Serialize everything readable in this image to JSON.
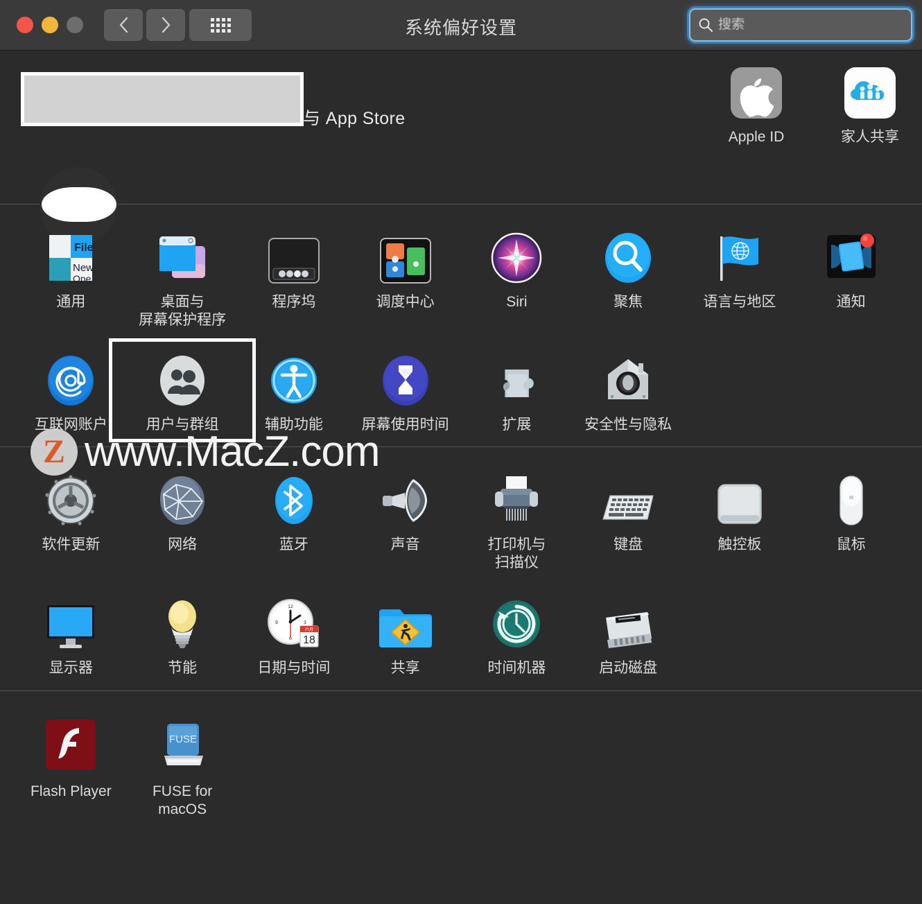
{
  "window": {
    "title": "系统偏好设置",
    "traffic_lights": [
      "close",
      "minimize",
      "zoom"
    ],
    "back_label": "‹",
    "forward_label": "›",
    "grid_label": "show-all"
  },
  "search": {
    "placeholder": "搜索",
    "value": ""
  },
  "banner": {
    "text": "与 App Store",
    "top_right_tiles": [
      {
        "label": "Apple ID",
        "icon": "apple-logo-icon"
      },
      {
        "label": "家人共享",
        "icon": "family-sharing-icon"
      }
    ]
  },
  "panes": {
    "row1": [
      {
        "label": "通用",
        "icon": "general-icon"
      },
      {
        "label": "桌面与\n屏幕保护程序",
        "icon": "desktop-screensaver-icon"
      },
      {
        "label": "程序坞",
        "icon": "dock-icon"
      },
      {
        "label": "调度中心",
        "icon": "mission-control-icon"
      },
      {
        "label": "Siri",
        "icon": "siri-icon"
      },
      {
        "label": "聚焦",
        "icon": "spotlight-icon"
      },
      {
        "label": "语言与地区",
        "icon": "language-region-icon"
      },
      {
        "label": "通知",
        "icon": "notifications-icon"
      }
    ],
    "row2": [
      {
        "label": "互联网账户",
        "icon": "internet-accounts-icon"
      },
      {
        "label": "用户与群组",
        "icon": "users-groups-icon",
        "selected": true
      },
      {
        "label": "辅助功能",
        "icon": "accessibility-icon"
      },
      {
        "label": "屏幕使用时间",
        "icon": "screen-time-icon"
      },
      {
        "label": "扩展",
        "icon": "extensions-icon"
      },
      {
        "label": "安全性与隐私",
        "icon": "security-privacy-icon"
      }
    ],
    "row3": [
      {
        "label": "软件更新",
        "icon": "software-update-icon"
      },
      {
        "label": "网络",
        "icon": "network-icon"
      },
      {
        "label": "蓝牙",
        "icon": "bluetooth-icon"
      },
      {
        "label": "声音",
        "icon": "sound-icon"
      },
      {
        "label": "打印机与\n扫描仪",
        "icon": "printers-scanners-icon"
      },
      {
        "label": "键盘",
        "icon": "keyboard-icon"
      },
      {
        "label": "触控板",
        "icon": "trackpad-icon"
      },
      {
        "label": "鼠标",
        "icon": "mouse-icon"
      }
    ],
    "row4": [
      {
        "label": "显示器",
        "icon": "displays-icon"
      },
      {
        "label": "节能",
        "icon": "energy-saver-icon"
      },
      {
        "label": "日期与时间",
        "icon": "date-time-icon"
      },
      {
        "label": "共享",
        "icon": "sharing-icon"
      },
      {
        "label": "时间机器",
        "icon": "time-machine-icon"
      },
      {
        "label": "启动磁盘",
        "icon": "startup-disk-icon"
      }
    ],
    "third_party": [
      {
        "label": "Flash Player",
        "icon": "flash-player-icon"
      },
      {
        "label": "FUSE for macOS",
        "icon": "fuse-macos-icon"
      }
    ]
  },
  "watermark": {
    "badge": "Z",
    "text": "www.MacZ.com"
  },
  "colors": {
    "window_bg": "#2b2b2b",
    "titlebar_bg": "#3a3a3a",
    "accent_blue": "#1fa4f3",
    "text": "#dcdcdc",
    "selection_border": "#ffffff",
    "search_focus": "#4d96d7",
    "watermark_orange": "#ec5a26"
  }
}
